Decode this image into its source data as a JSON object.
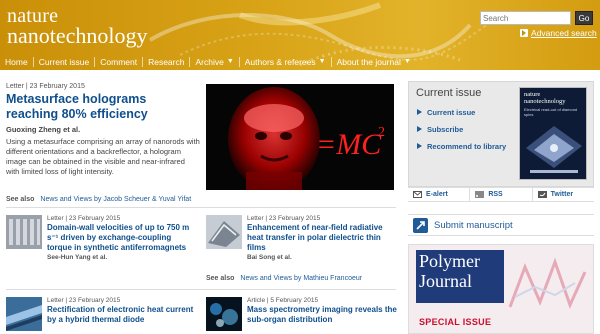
{
  "header": {
    "brand_line1": "nature",
    "brand_line2": "nanotechnology",
    "search_placeholder": "Search",
    "search_button": "Go",
    "advanced_search": "Advanced search"
  },
  "nav": {
    "items": [
      {
        "label": "Home"
      },
      {
        "label": "Current issue"
      },
      {
        "label": "Comment"
      },
      {
        "label": "Research"
      },
      {
        "label": "Archive",
        "has_menu": true
      },
      {
        "label": "Authors & referees",
        "has_menu": true
      },
      {
        "label": "About the journal",
        "has_menu": true
      }
    ]
  },
  "lead": {
    "meta": "Letter | 23 February 2015",
    "title": "Metasurface holograms reaching 80% efficiency",
    "authors": "Guoxing Zheng et al.",
    "abstract": "Using a metasurface comprising an array of nanorods with different orientations and a backreflector, a hologram image can be obtained in the visible and near-infrared with limited loss of light intensity.",
    "see_also_label": "See also",
    "see_also_link": "News and Views by Jacob Scheuer & Yuval Yifat"
  },
  "articles": [
    {
      "meta": "Letter | 23 February 2015",
      "title": "Domain-wall velocities of up to 750 m s⁻¹ driven by exchange-coupling torque in synthetic antiferromagnets",
      "authors": "See-Hun Yang et al."
    },
    {
      "meta": "Letter | 23 February 2015",
      "title": "Enhancement of near-field radiative heat transfer in polar dielectric thin films",
      "authors": "Bai Song et al.",
      "see_also_label": "See also",
      "see_also_link": "News and Views by Mathieu Francoeur"
    },
    {
      "meta": "Letter | 23 February 2015",
      "title": "Rectification of electronic heat current by a hybrid thermal diode"
    },
    {
      "meta": "Article | 5 February 2015",
      "title": "Mass spectrometry imaging reveals the sub-organ distribution"
    }
  ],
  "sidebar": {
    "current_issue_heading": "Current issue",
    "links": [
      "Current issue",
      "Subscribe",
      "Recommend to library"
    ],
    "cover_title_line1": "nature",
    "cover_title_line2": "nanotechnology",
    "cover_subtitle": "Electrical read-out of diamond spins",
    "share": [
      "E-alert",
      "RSS",
      "Twitter"
    ],
    "submit_label": "Submit manuscript",
    "ad_title_line1": "Polymer",
    "ad_title_line2": "Journal",
    "ad_special": "SPECIAL ISSUE"
  },
  "colors": {
    "header_gold": "#d9a418",
    "link_blue": "#1f5b98",
    "title_blue": "#0f4f8c",
    "ad_red": "#c8102e"
  }
}
